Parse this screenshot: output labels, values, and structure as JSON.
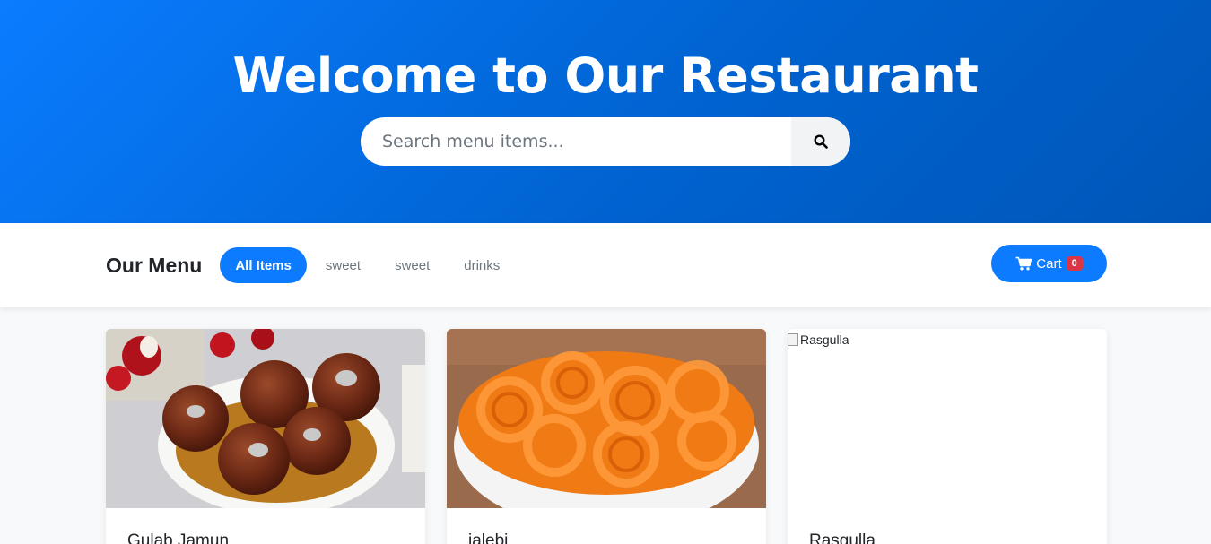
{
  "hero": {
    "title": "Welcome to Our Restaurant",
    "search_placeholder": "Search menu items...",
    "search_icon": "search-icon"
  },
  "menubar": {
    "title": "Our Menu",
    "filters": [
      "All Items",
      "sweet",
      "sweet",
      "drinks"
    ],
    "active_filter": "All Items",
    "cart_label": "Cart",
    "cart_count": "0",
    "cart_icon": "shopping-cart-icon"
  },
  "items": [
    {
      "name": "Gulab Jamun",
      "image": "gulab-jamun-photo"
    },
    {
      "name": "jalebi",
      "image": "jalebi-photo"
    },
    {
      "name": "Rasgulla",
      "image_alt": "Rasgulla",
      "image_broken": true
    }
  ],
  "colors": {
    "primary": "#0d7bff",
    "hero_gradient_start": "#0a7cff",
    "hero_gradient_end": "#0056b8",
    "badge": "#dc3545"
  }
}
